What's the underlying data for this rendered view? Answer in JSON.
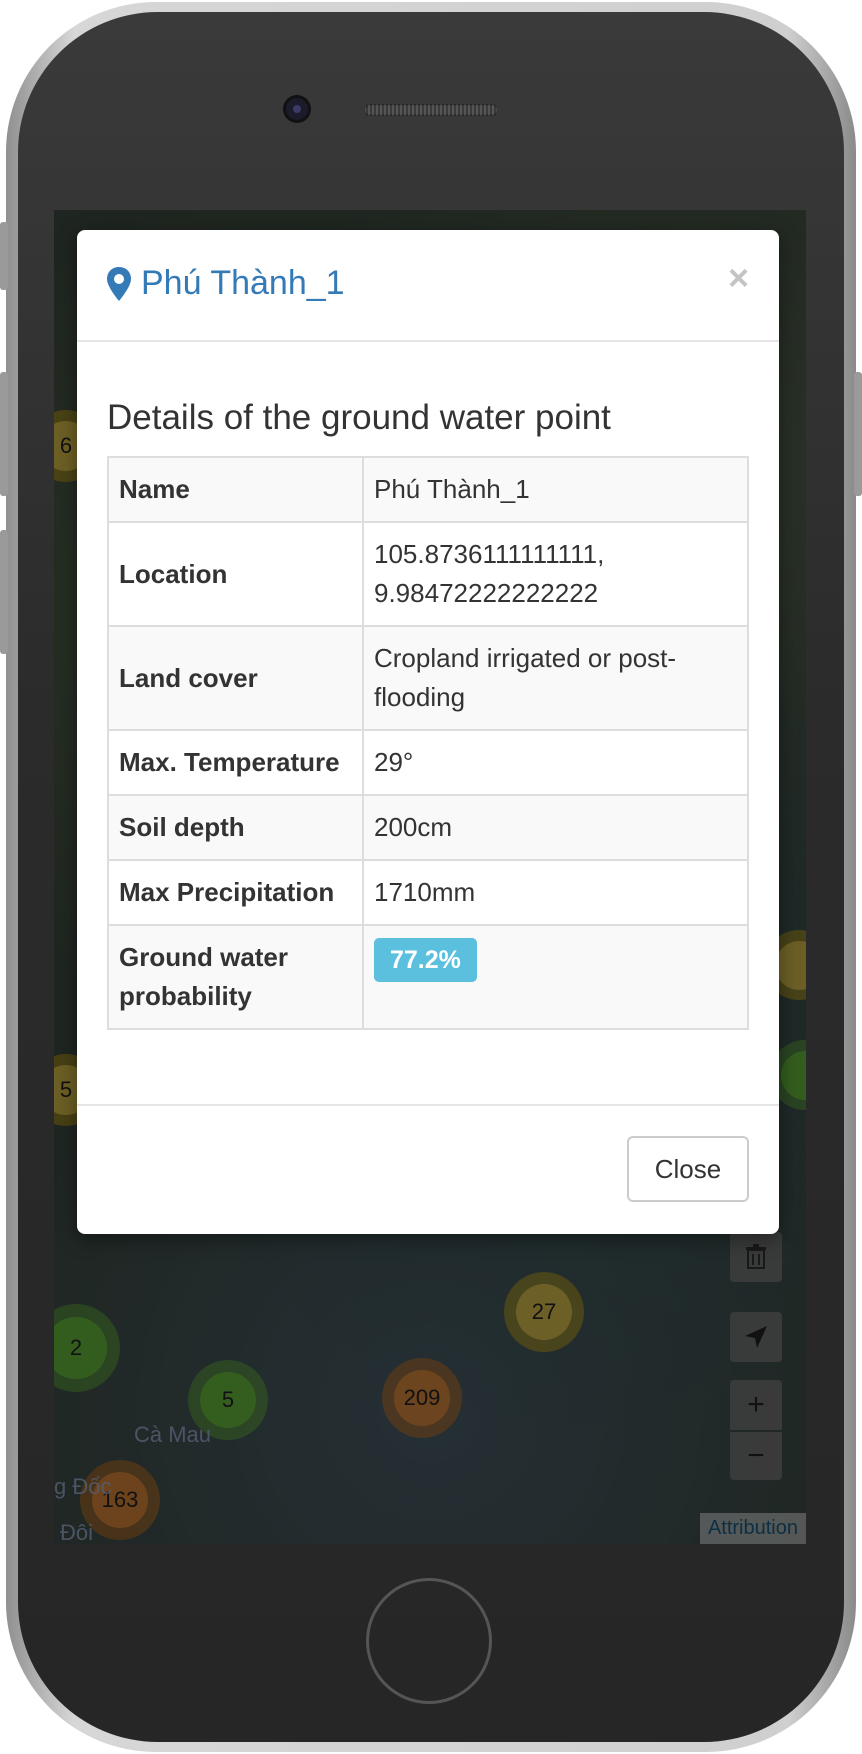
{
  "modal": {
    "title": "Phú Thành_1",
    "close_symbol": "×",
    "heading": "Details of the ground water point",
    "rows": [
      {
        "label": "Name",
        "value": "Phú Thành_1"
      },
      {
        "label": "Location",
        "value": "105.8736111111111, 9.98472222222222"
      },
      {
        "label": "Land cover",
        "value": "Cropland irrigated or post-flooding"
      },
      {
        "label": "Max. Temperature",
        "value": "29°"
      },
      {
        "label": "Soil depth",
        "value": "200cm"
      },
      {
        "label": "Max Precipitation",
        "value": "1710mm"
      },
      {
        "label": "Ground water probability",
        "value": "77.2%"
      }
    ],
    "close_button_label": "Close",
    "badge_color": "#5bc0de",
    "title_color": "#337ab7"
  },
  "map": {
    "clusters": [
      "6",
      "5",
      "2",
      "5",
      "209",
      "27",
      "163"
    ],
    "place_labels": [
      "Cà Mau",
      "g Đốc",
      "Đôi"
    ],
    "controls": {
      "zoom_in": "+",
      "zoom_out": "−"
    },
    "attribution": "Attribution",
    "icons": [
      "trash-icon",
      "locate-arrow-icon",
      "map-marker-icon"
    ]
  }
}
